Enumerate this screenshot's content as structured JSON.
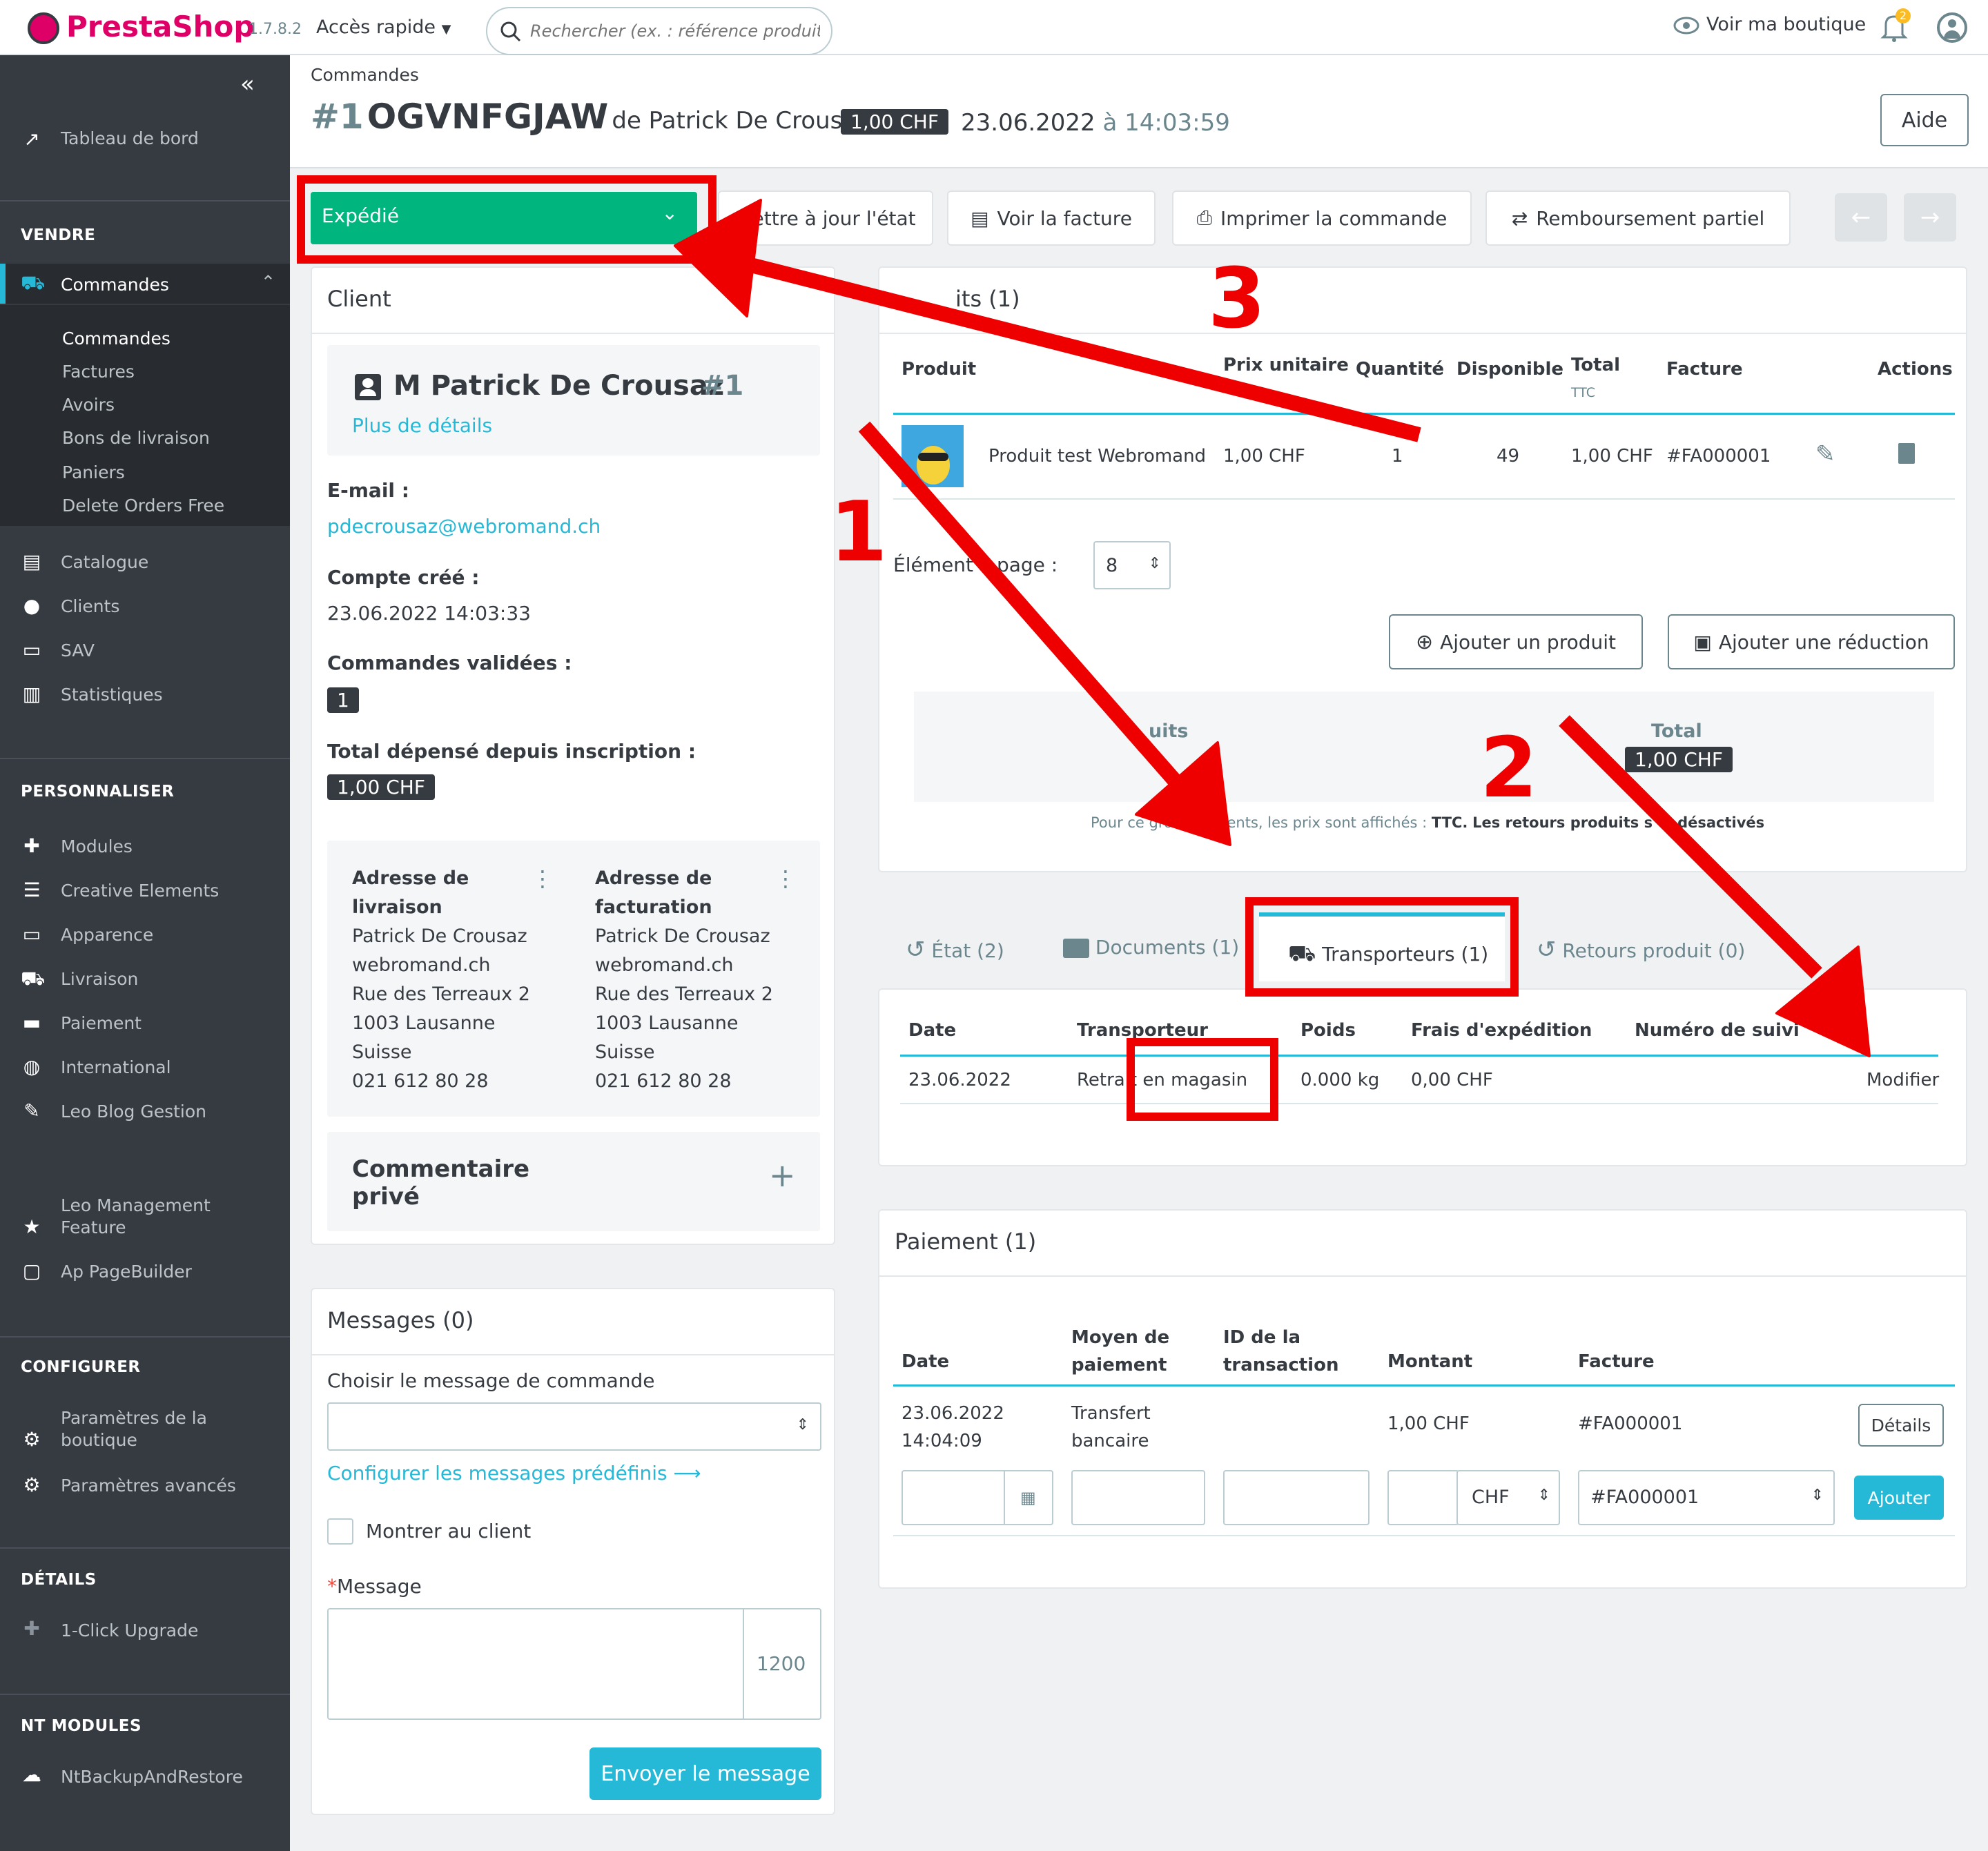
{
  "topbar": {
    "brand": "PrestaShop",
    "version": "1.7.8.2",
    "quick_access": "Accès rapide",
    "search_placeholder": "Rechercher (ex. : référence produit, no",
    "view_shop": "Voir ma boutique",
    "notif_count": "2"
  },
  "sidebar": {
    "dashboard": "Tableau de bord",
    "sec_sell": "VENDRE",
    "orders": "Commandes",
    "sub": [
      "Commandes",
      "Factures",
      "Avoirs",
      "Bons de livraison",
      "Paniers",
      "Delete Orders Free"
    ],
    "catalog": "Catalogue",
    "customers": "Clients",
    "sav": "SAV",
    "stats": "Statistiques",
    "sec_custom": "PERSONNALISER",
    "modules": "Modules",
    "creative": "Creative Elements",
    "appearance": "Apparence",
    "shipping": "Livraison",
    "payment": "Paiement",
    "international": "International",
    "leoblog": "Leo Blog Gestion",
    "leomgmt1": "Leo Management",
    "leomgmt2": "Feature",
    "pagebuilder": "Ap PageBuilder",
    "sec_config": "CONFIGURER",
    "shop_params1": "Paramètres de la",
    "shop_params2": "boutique",
    "adv_params": "Paramètres avancés",
    "sec_details": "DÉTAILS",
    "upgrade": "1-Click Upgrade",
    "sec_nt": "NT MODULES",
    "backup": "NtBackupAndRestore"
  },
  "header": {
    "breadcrumb": "Commandes",
    "order_num": "#1",
    "reference": "OGVNFGJAW",
    "customer": "de Patrick De Crousaz",
    "total": "1,00 CHF",
    "date": "23.06.2022",
    "at": "à",
    "time": "14:03:59",
    "help": "Aide"
  },
  "actions": {
    "status": "Expédié",
    "update_state": "Mettre à jour l'état",
    "view_invoice": "Voir la facture",
    "print": "Imprimer la commande",
    "refund": "Remboursement partiel"
  },
  "client": {
    "title": "Client",
    "name": "M Patrick De Crousaz",
    "id": "#1",
    "more": "Plus de détails",
    "email_label": "E-mail :",
    "email": "pdecrousaz@webromand.ch",
    "created_label": "Compte créé :",
    "created": "23.06.2022 14:03:33",
    "valid_label": "Commandes validées :",
    "valid": "1",
    "spent_label": "Total dépensé depuis inscription :",
    "spent": "1,00 CHF",
    "ship_title1": "Adresse de",
    "ship_title2": "livraison",
    "bill_title1": "Adresse de",
    "bill_title2": "facturation",
    "addr": [
      "Patrick De Crousaz",
      "webromand.ch",
      "Rue des Terreaux 2",
      "1003 Lausanne",
      "Suisse",
      "021 612 80 28"
    ],
    "comment1": "Commentaire",
    "comment2": "privé"
  },
  "messages": {
    "title": "Messages (0)",
    "choose": "Choisir le message de commande",
    "configure": "Configurer les messages prédéfinis",
    "show_client": "Montrer au client",
    "message_label": "Message",
    "counter": "1200",
    "send": "Envoyer le message"
  },
  "products": {
    "title_visible": "its (1)",
    "headers": [
      "Produit",
      "Prix unitaire",
      "Quantité",
      "Disponible",
      "Total",
      "TTC",
      "Facture",
      "Actions"
    ],
    "row": {
      "name": "Produit test Webromand",
      "price": "1,00 CHF",
      "qty": "1",
      "stock": "49",
      "total": "1,00 CHF",
      "invoice": "#FA000001"
    },
    "per_page_label": "Éléments par page :",
    "per_page_visible_a": "Élément",
    "per_page_visible_b": "page :",
    "per_page": "8",
    "add_product": "Ajouter un produit",
    "add_discount": "Ajouter une réduction",
    "summary_products": "uits",
    "summary_total_label": "Total",
    "summary_total": "1,00 CHF",
    "note_a": "Pour ce group",
    "note_b": "ents, les prix sont affichés :",
    "note_ttc": "TTC.",
    "note_ret": "Les retours produits s",
    "note_end": "désactivés"
  },
  "tabs": {
    "state": "État (2)",
    "documents": "Documents (1)",
    "carriers": "Transporteurs (1)",
    "returns": "Retours produit (0)"
  },
  "carriers": {
    "headers": [
      "Date",
      "Transporteur",
      "Poids",
      "Frais d'expédition",
      "Numéro de suivi"
    ],
    "row": {
      "date": "23.06.2022",
      "carrier": "Retrait en magasin",
      "weight": "0.000 kg",
      "fee": "0,00 CHF"
    },
    "edit": "Modifier"
  },
  "payment": {
    "title": "Paiement (1)",
    "headers": {
      "date": "Date",
      "method1": "Moyen de",
      "method2": "paiement",
      "txn1": "ID de la",
      "txn2": "transaction",
      "amount": "Montant",
      "invoice": "Facture"
    },
    "row": {
      "date1": "23.06.2022",
      "date2": "14:04:09",
      "method1": "Transfert",
      "method2": "bancaire",
      "amount": "1,00 CHF",
      "invoice": "#FA000001",
      "details": "Détails"
    },
    "currency": "CHF",
    "invoice_select": "#FA000001",
    "add": "Ajouter"
  },
  "annotations": {
    "n1": "1",
    "n2": "2",
    "n3": "3"
  },
  "colors": {
    "accent": "#25b9d7",
    "status": "#00b57e",
    "sidebar": "#363a41",
    "annotation": "#ee0000"
  }
}
